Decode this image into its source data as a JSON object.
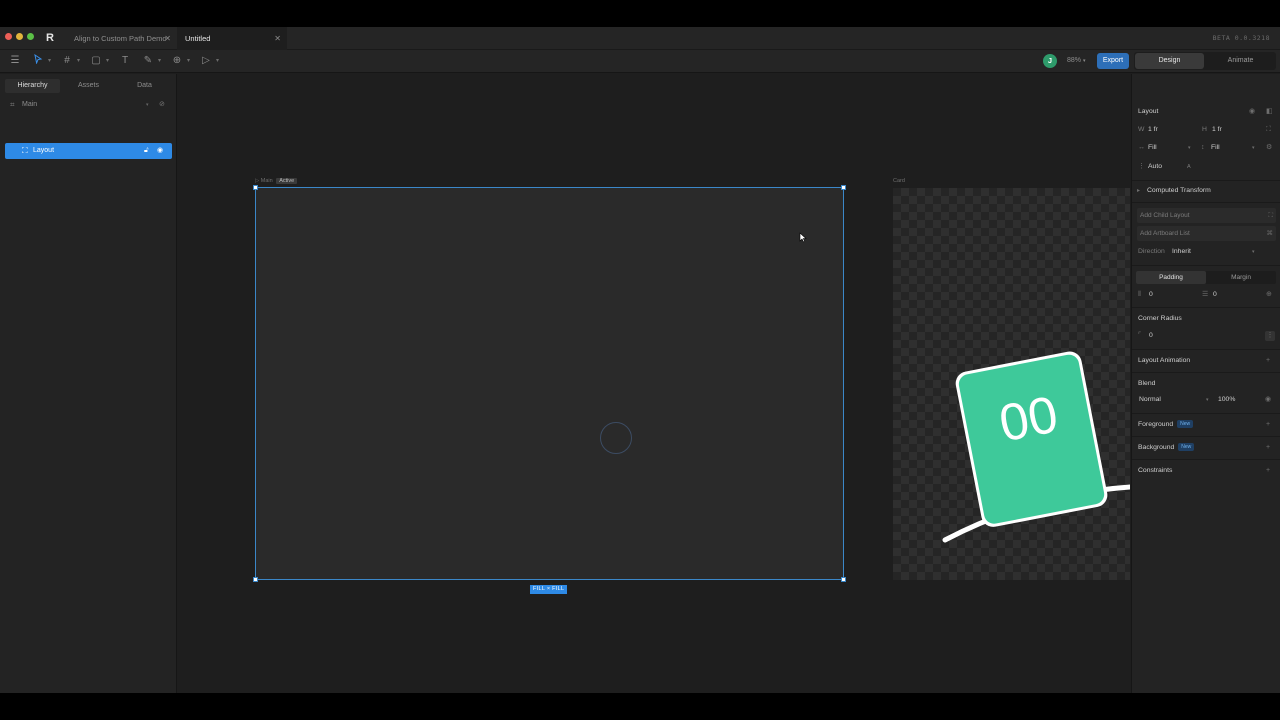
{
  "titlebar": {
    "tabs": [
      {
        "label": "Align to Custom Path Demo"
      },
      {
        "label": "Untitled"
      }
    ],
    "version": "BETA 0.0.3218"
  },
  "toolbar": {
    "avatar_initial": "J",
    "zoom": "88%",
    "export_label": "Export",
    "modes": [
      "Design",
      "Animate"
    ],
    "active_mode": "Design"
  },
  "left_panel": {
    "tabs": [
      "Hierarchy",
      "Assets",
      "Data"
    ],
    "active_tab": "Hierarchy",
    "tree": [
      {
        "label": "Main"
      },
      {
        "label": "Layout",
        "selected": true
      }
    ]
  },
  "canvas": {
    "main_label": "Main",
    "active_badge": "Active",
    "card_label": "Card",
    "fill_badge": "FILL × FILL",
    "card_counter": "00",
    "card_color": "#3ec99a"
  },
  "right_panel": {
    "layout_title": "Layout",
    "w_label": "W",
    "w_value": "1 fr",
    "h_label": "H",
    "h_value": "1 fr",
    "fill_x": "Fill",
    "fill_y": "Fill",
    "auto_label": "Auto",
    "auto_flag": "A",
    "computed_transform": "Computed Transform",
    "add_child_layout": "Add Child Layout",
    "add_artboard_list": "Add Artboard List",
    "direction_label": "Direction",
    "direction_value": "Inherit",
    "padding_tab": "Padding",
    "margin_tab": "Margin",
    "padding_h": "0",
    "padding_v": "0",
    "corner_radius_label": "Corner Radius",
    "corner_radius_value": "0",
    "layout_animation": "Layout Animation",
    "blend_label": "Blend",
    "blend_mode": "Normal",
    "blend_opacity": "100%",
    "foreground_label": "Foreground",
    "background_label": "Background",
    "new_badge": "New",
    "constraints_label": "Constraints"
  }
}
